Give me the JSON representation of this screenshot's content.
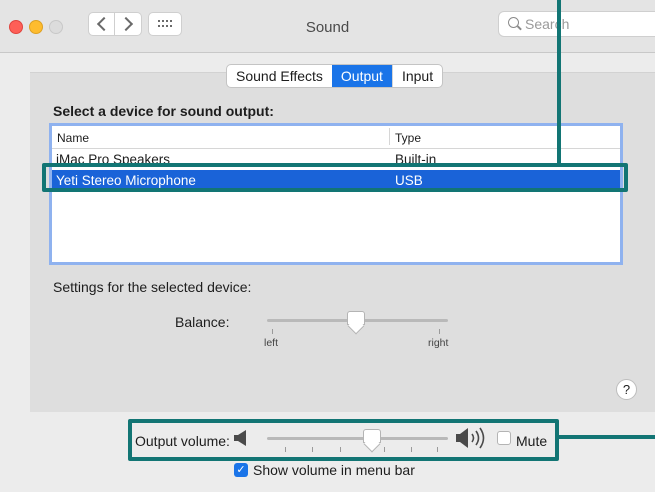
{
  "window": {
    "title": "Sound"
  },
  "search": {
    "placeholder": "Search"
  },
  "tabs": [
    {
      "label": "Sound Effects",
      "selected": false
    },
    {
      "label": "Output",
      "selected": true
    },
    {
      "label": "Input",
      "selected": false
    }
  ],
  "output": {
    "heading": "Select a device for sound output:",
    "columns": {
      "name": "Name",
      "type": "Type"
    },
    "devices": [
      {
        "name": "iMac Pro Speakers",
        "type": "Built-in",
        "selected": false
      },
      {
        "name": "Yeti Stereo Microphone",
        "type": "USB",
        "selected": true
      }
    ],
    "settings_label": "Settings for the selected device:",
    "balance": {
      "label": "Balance:",
      "left_label": "left",
      "right_label": "right",
      "value": 0.5
    }
  },
  "help": {
    "label": "?"
  },
  "volume": {
    "label": "Output volume:",
    "level": 0.55,
    "mute_label": "Mute",
    "mute_checked": false,
    "menu_bar_label": "Show volume in menu bar",
    "menu_bar_checked": true
  },
  "colors": {
    "accent": "#1a74e8",
    "selection": "#1a63d8",
    "annotation": "#127574"
  }
}
